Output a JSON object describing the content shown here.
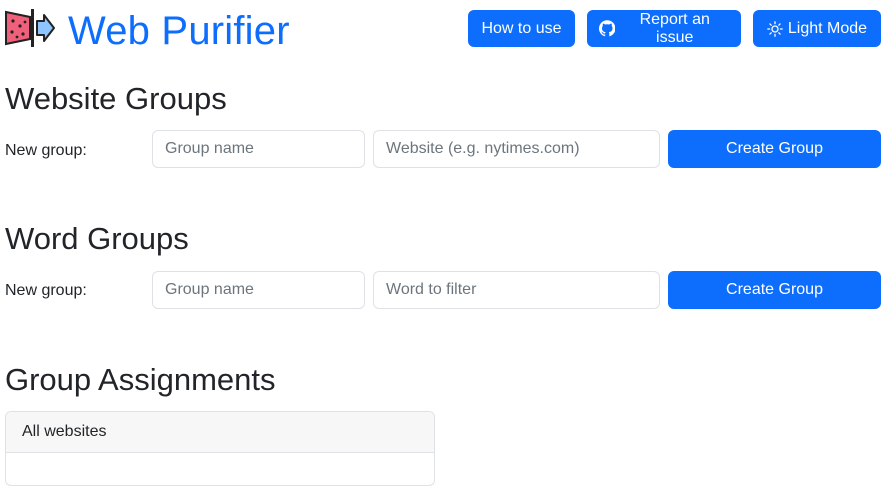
{
  "header": {
    "brand": "Web Purifier",
    "buttons": {
      "how_to_use": "How to use",
      "report_issue": "Report an issue",
      "light_mode": "Light Mode"
    },
    "icons": {
      "logo": "web-purifier-logo-icon",
      "report_issue": "github-icon",
      "light_mode": "sun-icon"
    }
  },
  "website_groups": {
    "title": "Website Groups",
    "label": "New group:",
    "name_placeholder": "Group name",
    "value_placeholder": "Website (e.g. nytimes.com)",
    "button": "Create Group"
  },
  "word_groups": {
    "title": "Word Groups",
    "label": "New group:",
    "name_placeholder": "Group name",
    "value_placeholder": "Word to filter",
    "button": "Create Group"
  },
  "group_assignments": {
    "title": "Group Assignments",
    "card_header": "All websites"
  },
  "colors": {
    "primary": "#0d6efd",
    "text": "#212529",
    "border": "#dee2e6"
  }
}
